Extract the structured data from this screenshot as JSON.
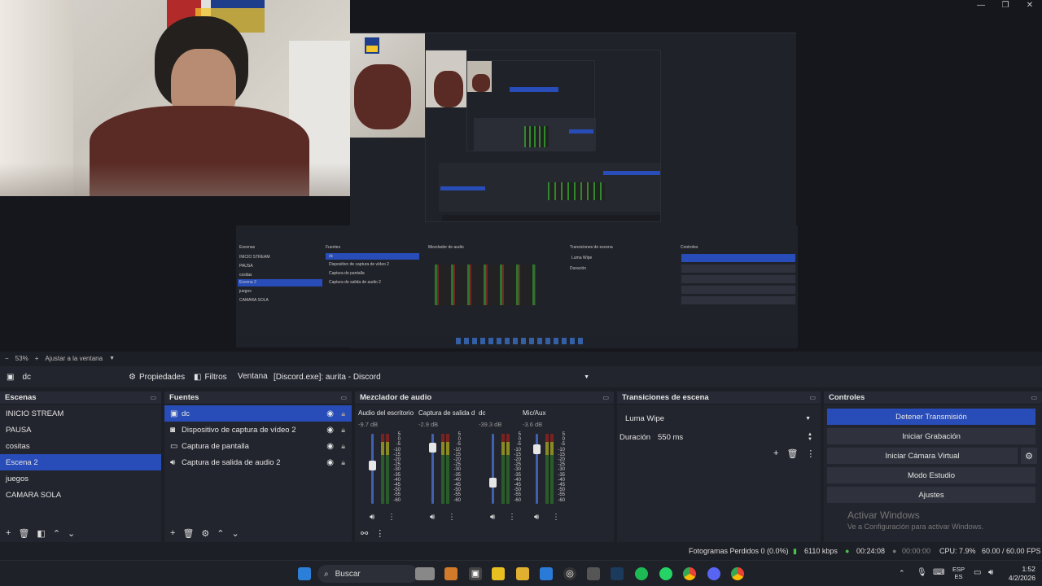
{
  "preview": {
    "zoom": "53%",
    "fit_label": "Ajustar a la ventana"
  },
  "context_bar": {
    "source_name": "dc",
    "properties_label": "Propiedades",
    "filters_label": "Filtros",
    "window_label": "Ventana",
    "window_value": "[Discord.exe]: aurita - Discord"
  },
  "scenes": {
    "title": "Escenas",
    "items": [
      "INICIO STREAM",
      "PAUSA",
      "cositas",
      "Escena 2",
      "juegos",
      "CAMARA SOLA"
    ],
    "selected_index": 3
  },
  "sources": {
    "title": "Fuentes",
    "items": [
      {
        "name": "dc",
        "icon": "window-capture-icon"
      },
      {
        "name": "Dispositivo de captura de vídeo 2",
        "icon": "camera-icon"
      },
      {
        "name": "Captura de pantalla",
        "icon": "monitor-icon"
      },
      {
        "name": "Captura de salida de audio 2",
        "icon": "speaker-icon"
      }
    ]
  },
  "mixer": {
    "title": "Mezclador de audio",
    "channels": [
      {
        "name": "Audio del escritorio",
        "db": "-9.7 dB",
        "level": 0.55
      },
      {
        "name": "Captura de salida d",
        "db": "-2.9 dB",
        "level": 0.8
      },
      {
        "name": "dc",
        "db": "-39.3 dB",
        "level": 0.3
      },
      {
        "name": "Mic/Aux",
        "db": "-3.6 dB",
        "level": 0.78
      }
    ],
    "scale": [
      "5",
      "0",
      "-5",
      "-10",
      "-15",
      "-20",
      "-25",
      "-30",
      "-35",
      "-40",
      "-45",
      "-50",
      "-55",
      "-60"
    ]
  },
  "transitions": {
    "title": "Transiciones de escena",
    "selected": "Luma Wipe",
    "duration_label": "Duración",
    "duration_value": "550 ms"
  },
  "controls": {
    "title": "Controles",
    "stop_stream": "Detener Transmisión",
    "start_recording": "Iniciar Grabación",
    "start_virtual_cam": "Iniciar Cámara Virtual",
    "studio_mode": "Modo Estudio",
    "settings": "Ajustes"
  },
  "watermark": {
    "title": "Activar Windows",
    "subtitle": "Ve a Configuración para activar Windows."
  },
  "status": {
    "dropped_frames": "Fotogramas Perdidos 0 (0.0%)",
    "bitrate": "6110 kbps",
    "stream_time": "00:24:08",
    "rec_time": "00:00:00",
    "cpu": "CPU: 7.9%",
    "fps": "60.00 / 60.00 FPS"
  },
  "taskbar": {
    "search_label": "Buscar",
    "lang_1": "ESP",
    "lang_2": "ES",
    "time": "1:52",
    "date": "4/2/2026"
  },
  "colors": {
    "accent": "#284cb8",
    "panel": "#23252e",
    "background": "#1d1f26"
  }
}
